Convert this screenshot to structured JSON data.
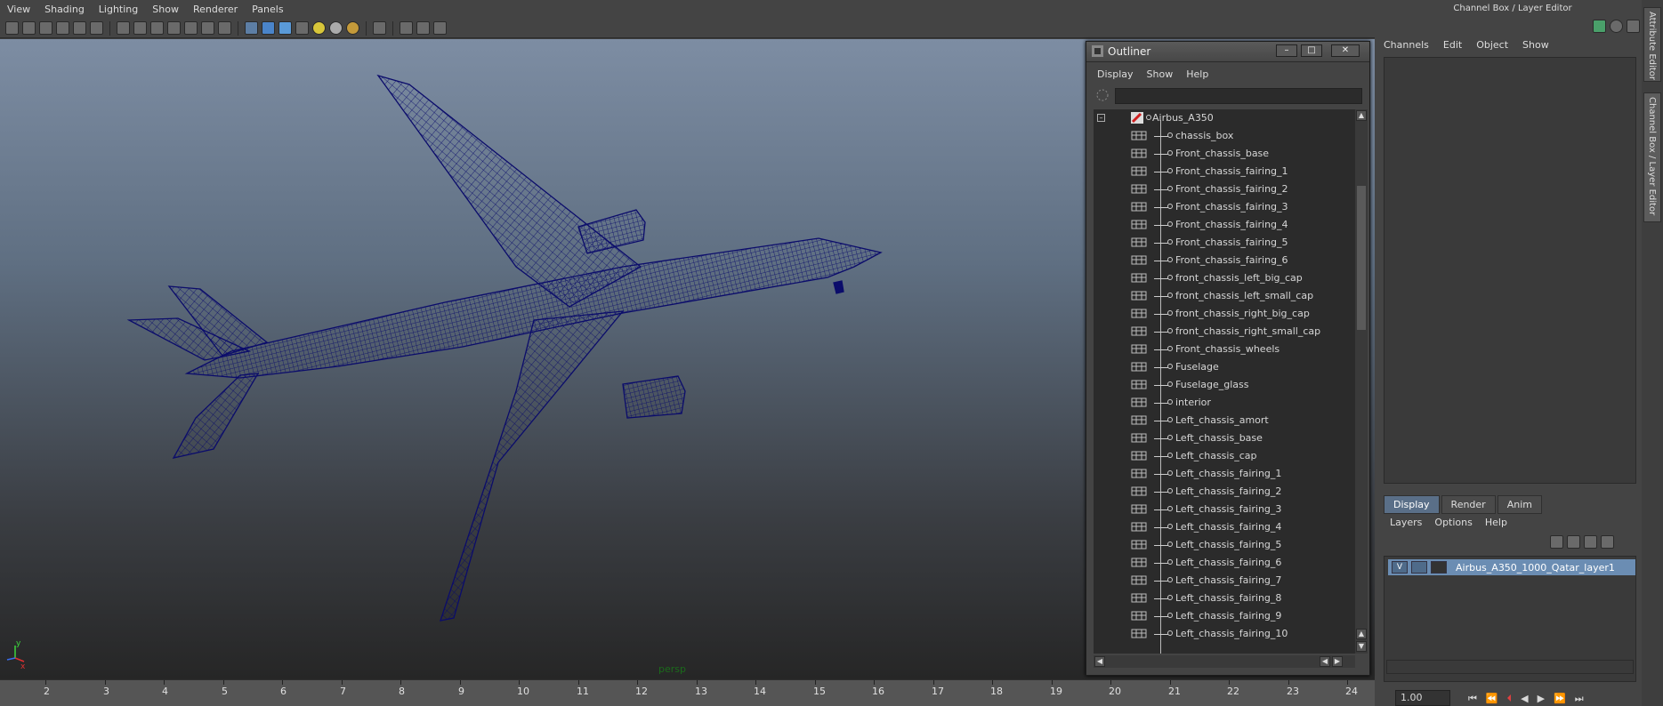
{
  "viewport": {
    "menus": [
      "View",
      "Shading",
      "Lighting",
      "Show",
      "Renderer",
      "Panels"
    ],
    "camera_label": "persp",
    "axis_labels": {
      "y": "y",
      "x": "x"
    }
  },
  "timeline": {
    "ticks": [
      "2",
      "3",
      "4",
      "5",
      "6",
      "7",
      "8",
      "9",
      "10",
      "11",
      "12",
      "13",
      "14",
      "15",
      "16",
      "17",
      "18",
      "19",
      "20",
      "21",
      "22",
      "23",
      "24"
    ]
  },
  "outliner": {
    "title": "Outliner",
    "menus": [
      "Display",
      "Show",
      "Help"
    ],
    "window_buttons": [
      "minimize",
      "maximize",
      "close"
    ],
    "root": "Airbus_A350",
    "children": [
      "chassis_box",
      "Front_chassis_base",
      "Front_chassis_fairing_1",
      "Front_chassis_fairing_2",
      "Front_chassis_fairing_3",
      "Front_chassis_fairing_4",
      "Front_chassis_fairing_5",
      "Front_chassis_fairing_6",
      "front_chassis_left_big_cap",
      "front_chassis_left_small_cap",
      "front_chassis_right_big_cap",
      "front_chassis_right_small_cap",
      "Front_chassis_wheels",
      "Fuselage",
      "Fuselage_glass",
      "interior",
      "Left_chassis_amort",
      "Left_chassis_base",
      "Left_chassis_cap",
      "Left_chassis_fairing_1",
      "Left_chassis_fairing_2",
      "Left_chassis_fairing_3",
      "Left_chassis_fairing_4",
      "Left_chassis_fairing_5",
      "Left_chassis_fairing_6",
      "Left_chassis_fairing_7",
      "Left_chassis_fairing_8",
      "Left_chassis_fairing_9",
      "Left_chassis_fairing_10"
    ]
  },
  "channel_box": {
    "title": "Channel Box / Layer Editor",
    "menus": [
      "Channels",
      "Edit",
      "Object",
      "Show"
    ],
    "side_tabs": [
      "Attribute Editor",
      "Channel Box / Layer Editor"
    ]
  },
  "layer_editor": {
    "tabs": [
      "Display",
      "Render",
      "Anim"
    ],
    "active_tab": "Display",
    "menus": [
      "Layers",
      "Options",
      "Help"
    ],
    "layer": {
      "visibility": "V",
      "name": "Airbus_A350_1000_Qatar_layer1"
    }
  },
  "playback": {
    "frame_value": "1.00"
  },
  "colors": {
    "wireframe": "#0b0c6b",
    "selected_layer": "#6b8db3",
    "camera_label": "#1b6b1b"
  }
}
